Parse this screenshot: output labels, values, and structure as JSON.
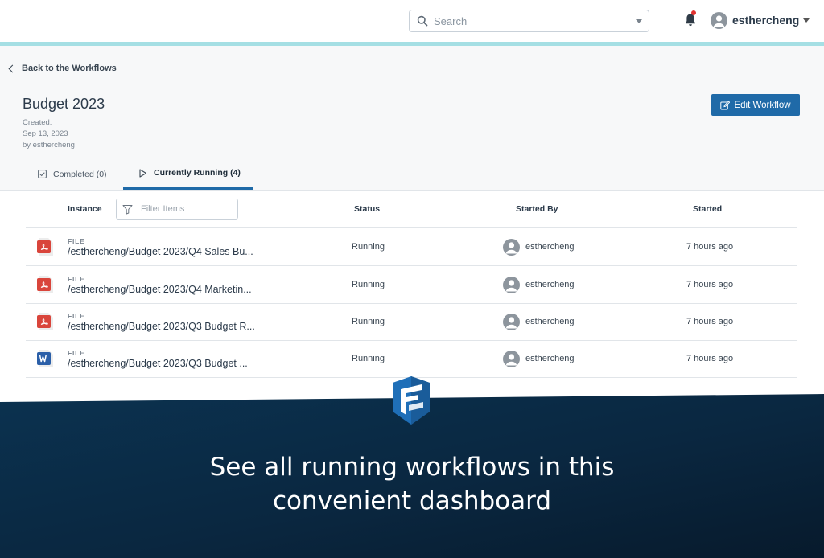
{
  "topbar": {
    "search_placeholder": "Search",
    "username": "esthercheng",
    "icons": {
      "search": "search-icon",
      "notification": "bell-icon",
      "avatar": "user-avatar-icon"
    }
  },
  "header": {
    "back_label": "Back to the Workflows",
    "title": "Budget 2023",
    "created_label": "Created:",
    "created_date": "Sep 13, 2023",
    "created_by": "by esthercheng",
    "edit_button": "Edit Workflow"
  },
  "tabs": [
    {
      "label": "Completed (0)",
      "icon": "check-square-icon",
      "active": false
    },
    {
      "label": "Currently Running (4)",
      "icon": "play-icon",
      "active": true
    }
  ],
  "table": {
    "columns": {
      "instance": "Instance",
      "status": "Status",
      "started_by": "Started By",
      "started": "Started"
    },
    "filter_placeholder": "Filter Items",
    "rows": [
      {
        "type": "FILE",
        "file_icon": "pdf-file-icon",
        "path": "/esthercheng/Budget 2023/Q4 Sales Bu...",
        "status": "Running",
        "started_by": "esthercheng",
        "started": "7 hours ago"
      },
      {
        "type": "FILE",
        "file_icon": "pdf-file-icon",
        "path": "/esthercheng/Budget 2023/Q4 Marketin...",
        "status": "Running",
        "started_by": "esthercheng",
        "started": "7 hours ago"
      },
      {
        "type": "FILE",
        "file_icon": "pdf-file-icon",
        "path": "/esthercheng/Budget 2023/Q3 Budget R...",
        "status": "Running",
        "started_by": "esthercheng",
        "started": "7 hours ago"
      },
      {
        "type": "FILE",
        "file_icon": "word-file-icon",
        "path": "/esthercheng/Budget 2023/Q3 Budget ...",
        "status": "Running",
        "started_by": "esthercheng",
        "started": "7 hours ago"
      }
    ]
  },
  "banner": {
    "logo": "filecloud-logo",
    "line1": "See all running workflows in this",
    "line2": "convenient dashboard"
  },
  "colors": {
    "accent": "#1f6aa8",
    "topbar_accent": "#a5dfe4",
    "banner_dark": "#0c2a43",
    "pdf_red": "#d9453b",
    "word_blue": "#2b5fa8",
    "notification_dot": "#e0312f"
  }
}
